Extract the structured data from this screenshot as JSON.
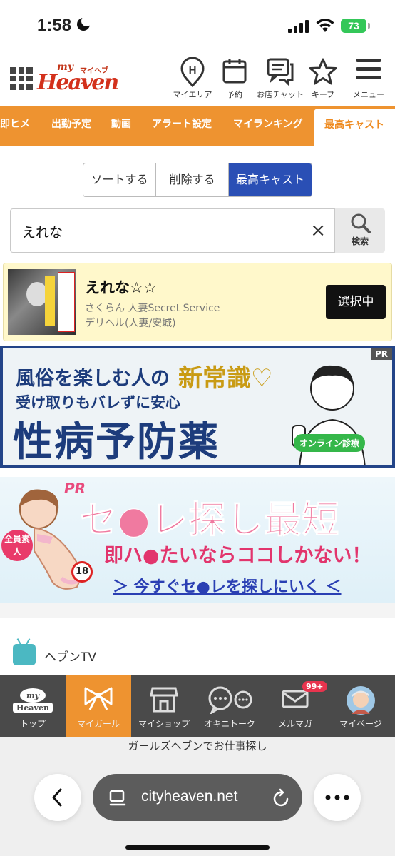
{
  "status": {
    "time": "1:58",
    "battery": "73"
  },
  "header": {
    "logo_my": "my",
    "logo_kana": "マイヘブン",
    "logo_main": "Heaven",
    "nav": [
      {
        "label": "マイエリア",
        "icon": "map-pin-h-icon"
      },
      {
        "label": "予約",
        "icon": "calendar-icon"
      },
      {
        "label": "お店チャット",
        "icon": "chat-icon"
      },
      {
        "label": "キープ",
        "icon": "star-icon"
      },
      {
        "label": "メニュー",
        "icon": "hamburger-icon"
      }
    ]
  },
  "tabs": [
    "即ヒメ",
    "出勤予定",
    "動画",
    "アラート設定",
    "マイランキング",
    "最高キャスト"
  ],
  "segment": [
    "ソートする",
    "削除する",
    "最高キャスト"
  ],
  "search": {
    "value": "えれな",
    "clear": "×",
    "button": "検索"
  },
  "cast": {
    "name": "えれな☆☆",
    "shop": "さくらん 人妻Secret Service",
    "category": "デリヘル(人妻/安城)",
    "select_label": "選択中"
  },
  "banner1": {
    "pr": "PR",
    "line1a": "風俗を楽しむ人の",
    "line1b": "新常識♡",
    "line2": "受け取りもバレずに安心",
    "line3": "性病予防薬",
    "badge": "オンライン診療"
  },
  "banner2": {
    "pr": "PR",
    "title": "セ●レ探し最短",
    "sub": "即ハ●たいならココしかない！",
    "link": "＞ 今すぐセ●レを探しにいく ＜",
    "badge": "全員素人",
    "age": "18"
  },
  "tv": {
    "label": "ヘブンTV"
  },
  "tabbar": [
    {
      "label": "トップ",
      "icon": "my-heaven-logo-icon"
    },
    {
      "label": "マイガール",
      "icon": "ribbon-icon"
    },
    {
      "label": "マイショップ",
      "icon": "shop-icon"
    },
    {
      "label": "オキニトーク",
      "icon": "talk-bubbles-icon"
    },
    {
      "label": "メルマガ",
      "icon": "mail-icon",
      "badge": "99+"
    },
    {
      "label": "マイページ",
      "icon": "avatar-icon"
    }
  ],
  "recruit": "ガールズヘブンでお仕事探し",
  "safari": {
    "url": "cityheaven.net"
  },
  "colors": {
    "accent": "#ee9330",
    "segment_active": "#2a4fb5",
    "brand_red": "#d3311c"
  }
}
